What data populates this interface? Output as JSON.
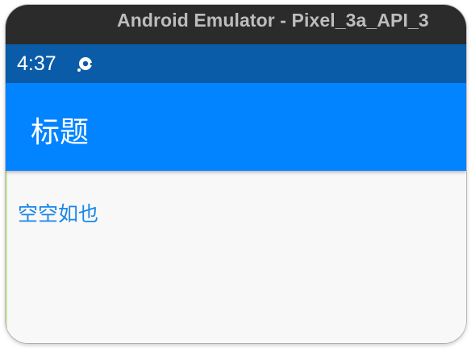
{
  "window": {
    "title": "Android Emulator - Pixel_3a_API_3"
  },
  "status_bar": {
    "time": "4:37",
    "notification_icon": "podcast-icon"
  },
  "app_bar": {
    "title": "标题"
  },
  "content": {
    "empty_text": "空空如也"
  },
  "colors": {
    "titlebar": "#2b2b2b",
    "status_bar": "#0a5ca9",
    "app_bar": "#0283ff",
    "empty_text": "#1a86e8",
    "background": "#f8f8f8"
  }
}
